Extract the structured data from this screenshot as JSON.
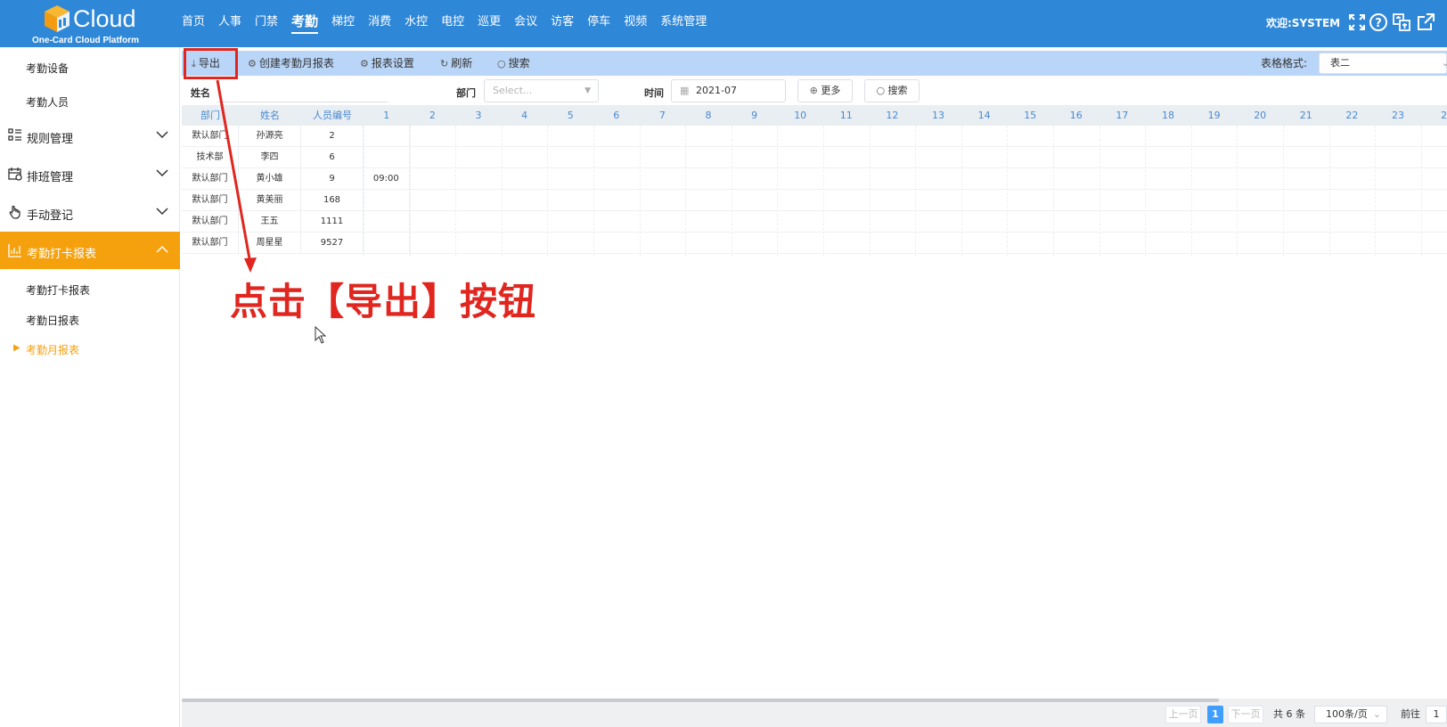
{
  "brand": {
    "name": "Cloud",
    "subtitle": "One-Card Cloud Platform"
  },
  "nav": [
    "首页",
    "人事",
    "门禁",
    "考勤",
    "梯控",
    "消费",
    "水控",
    "电控",
    "巡更",
    "会议",
    "访客",
    "停车",
    "视频",
    "系统管理"
  ],
  "nav_active": "考勤",
  "welcome": "欢迎:SYSTEM",
  "sidebar": {
    "sub_top": [
      "考勤设备",
      "考勤人员"
    ],
    "groups": [
      {
        "label": "规则管理",
        "icon": "list-icon"
      },
      {
        "label": "排班管理",
        "icon": "calendar-icon"
      },
      {
        "label": "手动登记",
        "icon": "hand-icon"
      },
      {
        "label": "考勤打卡报表",
        "icon": "chart-icon"
      }
    ],
    "sub_reports": [
      "考勤打卡报表",
      "考勤日报表",
      "考勤月报表"
    ]
  },
  "toolbar": {
    "export": "导出",
    "create": "创建考勤月报表",
    "settings": "报表设置",
    "refresh": "刷新",
    "search": "搜索",
    "format_label": "表格格式:",
    "format_value": "表二"
  },
  "filters": {
    "name_label": "姓名",
    "name_value": "",
    "dept_label": "部门",
    "dept_placeholder": "Select...",
    "time_label": "时间",
    "time_value": "2021-07",
    "more": "更多",
    "search": "搜索"
  },
  "table": {
    "headers": [
      "部门",
      "姓名",
      "人员编号"
    ],
    "days": [
      "1",
      "2",
      "3",
      "4",
      "5",
      "6",
      "7",
      "8",
      "9",
      "10",
      "11",
      "12",
      "13",
      "14",
      "15",
      "16",
      "17",
      "18",
      "19",
      "20",
      "21",
      "22",
      "23",
      "2"
    ],
    "rows": [
      {
        "dept": "默认部门",
        "name": "孙源亮",
        "id": "2",
        "day1": ""
      },
      {
        "dept": "技术部",
        "name": "李四",
        "id": "6",
        "day1": ""
      },
      {
        "dept": "默认部门",
        "name": "黄小雄",
        "id": "9",
        "day1": "09:00"
      },
      {
        "dept": "默认部门",
        "name": "黄美丽",
        "id": "168",
        "day1": ""
      },
      {
        "dept": "默认部门",
        "name": "王五",
        "id": "1111",
        "day1": ""
      },
      {
        "dept": "默认部门",
        "name": "周星星",
        "id": "9527",
        "day1": ""
      }
    ]
  },
  "annotation": "点击【导出】按钮",
  "pagination": {
    "prev": "上一页",
    "current": "1",
    "next": "下一页",
    "total": "共 6 条",
    "page_size": "100条/页",
    "goto_label": "前往",
    "goto_value": "1"
  },
  "colors": {
    "topbar": "#2f87d8",
    "accent": "#f5a10e",
    "toolbar": "#b9d5f7",
    "highlight": "#e0261f"
  }
}
